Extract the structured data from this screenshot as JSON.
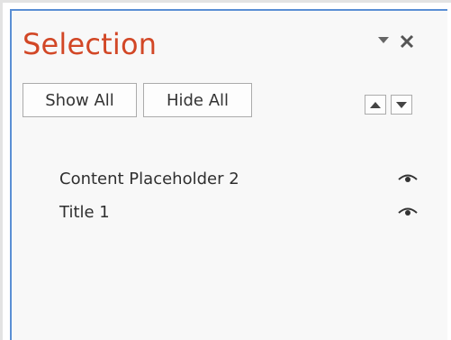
{
  "pane": {
    "title": "Selection",
    "options_icon": "chevron-down-icon",
    "close_icon": "close-icon"
  },
  "toolbar": {
    "show_all_label": "Show All",
    "hide_all_label": "Hide All",
    "bring_forward_icon": "triangle-up-icon",
    "send_backward_icon": "triangle-down-icon"
  },
  "objects": {
    "items": [
      {
        "label": "Content Placeholder 2",
        "visibility_icon": "eye-icon"
      },
      {
        "label": "Title 1",
        "visibility_icon": "eye-icon"
      }
    ]
  },
  "colors": {
    "title": "#d24726",
    "accent_border": "#5a8fd4",
    "pane_background": "#f8f8f8"
  }
}
